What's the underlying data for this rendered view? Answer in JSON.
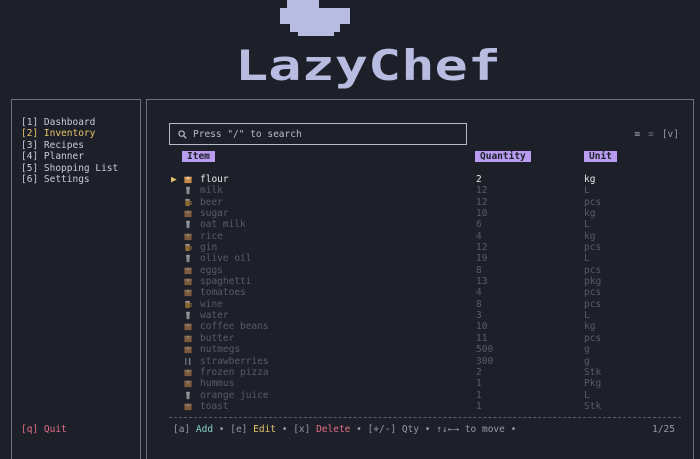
{
  "app": {
    "title": "LazyChef"
  },
  "colors": {
    "accent": "#b79cf0",
    "active": "#e6c36a",
    "quit": "#e26d86",
    "add": "#7fd4c6"
  },
  "sidebar": {
    "items": [
      {
        "label": "[1] Dashboard"
      },
      {
        "label": "[2] Inventory"
      },
      {
        "label": "[3] Recipes"
      },
      {
        "label": "[4] Planner"
      },
      {
        "label": "[5] Shopping List"
      },
      {
        "label": "[6] Settings"
      }
    ],
    "active_index": 1,
    "quit_label": "[q] Quit"
  },
  "search": {
    "placeholder": "Press \"/\" to search",
    "icon": "search-icon"
  },
  "view_toggle": {
    "list_icon": "≡",
    "grid_icon": "≡",
    "label": "[v]"
  },
  "table": {
    "columns": {
      "item": "Item",
      "quantity": "Quantity",
      "unit": "Unit"
    },
    "selected_index": 0,
    "pointer": "▶",
    "rows": [
      {
        "name": "flour",
        "qty": "2",
        "unit": "kg",
        "icon": "box-icon"
      },
      {
        "name": "milk",
        "qty": "12",
        "unit": "L",
        "icon": "glass-icon"
      },
      {
        "name": "beer",
        "qty": "12",
        "unit": "pcs",
        "icon": "beer-icon"
      },
      {
        "name": "sugar",
        "qty": "10",
        "unit": "kg",
        "icon": "box-icon"
      },
      {
        "name": "oat milk",
        "qty": "6",
        "unit": "L",
        "icon": "glass-icon"
      },
      {
        "name": "rice",
        "qty": "4",
        "unit": "kg",
        "icon": "box-icon"
      },
      {
        "name": "gin",
        "qty": "12",
        "unit": "pcs",
        "icon": "beer-icon"
      },
      {
        "name": "olive oil",
        "qty": "19",
        "unit": "L",
        "icon": "glass-icon"
      },
      {
        "name": "eggs",
        "qty": "8",
        "unit": "pcs",
        "icon": "box-icon"
      },
      {
        "name": "spaghetti",
        "qty": "13",
        "unit": "pkg",
        "icon": "box-icon"
      },
      {
        "name": "tomatoes",
        "qty": "4",
        "unit": "pcs",
        "icon": "box-icon"
      },
      {
        "name": "wine",
        "qty": "8",
        "unit": "pcs",
        "icon": "beer-icon"
      },
      {
        "name": "water",
        "qty": "3",
        "unit": "L",
        "icon": "glass-icon"
      },
      {
        "name": "coffee beans",
        "qty": "10",
        "unit": "kg",
        "icon": "box-icon"
      },
      {
        "name": "butter",
        "qty": "11",
        "unit": "pcs",
        "icon": "box-icon"
      },
      {
        "name": "nutmegs",
        "qty": "500",
        "unit": "g",
        "icon": "box-icon"
      },
      {
        "name": "strawberries",
        "qty": "300",
        "unit": "g",
        "icon": "cutlery-icon"
      },
      {
        "name": "frozen pizza",
        "qty": "2",
        "unit": "Stk",
        "icon": "box-icon"
      },
      {
        "name": "hummus",
        "qty": "1",
        "unit": "Pkg",
        "icon": "box-icon"
      },
      {
        "name": "orange juice",
        "qty": "1",
        "unit": "L",
        "icon": "glass-icon"
      },
      {
        "name": "toast",
        "qty": "1",
        "unit": "Stk",
        "icon": "box-icon"
      }
    ]
  },
  "footer": {
    "add_key": "[a] ",
    "add_label": "Add",
    "edit_key": "[e] ",
    "edit_label": "Edit",
    "delete_key": "[x] ",
    "delete_label": "Delete",
    "qty_hint": "[+/-] Qty",
    "move_hint": "↑↓←→ to move",
    "sep": " • ",
    "pager": "1/25"
  }
}
